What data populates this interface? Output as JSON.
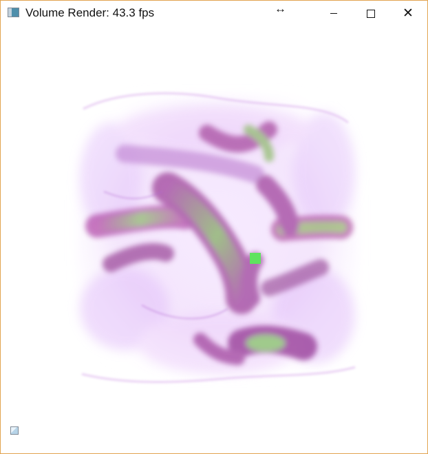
{
  "window": {
    "title": "Volume Render: 43.3 fps",
    "cursor_glyph": "↔",
    "controls": {
      "minimize": "minimize-icon",
      "maximize": "maximize-icon",
      "close": "close-icon",
      "close_glyph": "✕"
    }
  },
  "render": {
    "colors": {
      "background": "#ffffff",
      "volume_tint": "#c98ee8",
      "volume_deep": "#8f2f8f",
      "highlight": "#7fd35d",
      "marker": "#5fe35f"
    }
  }
}
